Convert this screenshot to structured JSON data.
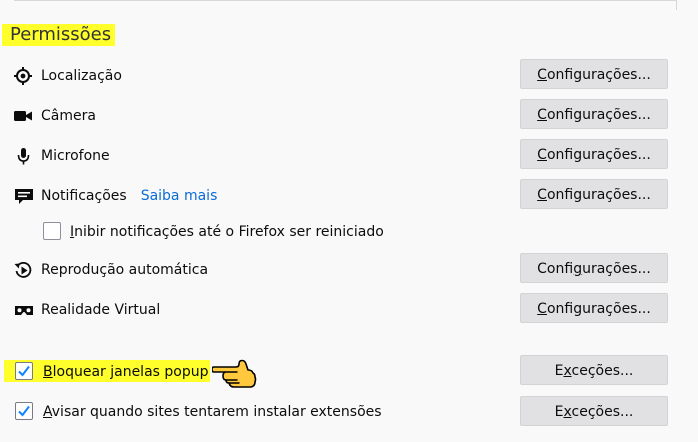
{
  "section": {
    "title": "Permissões"
  },
  "permissions": [
    {
      "key": "location",
      "label": "Localização",
      "icon": "location-icon",
      "button": {
        "pre": "",
        "u": "C",
        "post": "onfigurações..."
      }
    },
    {
      "key": "camera",
      "label": "Câmera",
      "icon": "camera-icon",
      "button": {
        "pre": "",
        "u": "C",
        "post": "onfigurações..."
      }
    },
    {
      "key": "microphone",
      "label": "Microfone",
      "icon": "microphone-icon",
      "button": {
        "pre": "",
        "u": "C",
        "post": "onfigurações..."
      }
    },
    {
      "key": "notifications",
      "label": "Notificações",
      "link": "Saiba mais",
      "icon": "notifications-icon",
      "button": {
        "pre": "",
        "u": "C",
        "post": "onfigurações..."
      }
    },
    {
      "key": "autoplay",
      "label": "Reprodução automática",
      "icon": "autoplay-icon",
      "button": {
        "pre": "Confi",
        "u": "g",
        "post": "urações..."
      }
    },
    {
      "key": "vr",
      "label": "Realidade Virtual",
      "icon": "vr-headset-icon",
      "button": {
        "pre": "",
        "u": "C",
        "post": "onfigurações..."
      }
    }
  ],
  "pause_notifications": {
    "checked": false,
    "u": "I",
    "rest": "nibir notificações até o Firefox ser reiniciado"
  },
  "block_popups": {
    "checked": true,
    "u": "B",
    "rest": "loquear janelas popup",
    "button": {
      "pre": "E",
      "u": "x",
      "post": "ceções..."
    }
  },
  "warn_addons": {
    "checked": true,
    "u": "A",
    "rest": "visar quando sites tentarem instalar extensões",
    "button": {
      "pre": "E",
      "u": "x",
      "post": "ceções..."
    }
  },
  "colors": {
    "highlight": "#ffff2b",
    "link": "#0a6bd6",
    "check": "#0a84ff"
  }
}
